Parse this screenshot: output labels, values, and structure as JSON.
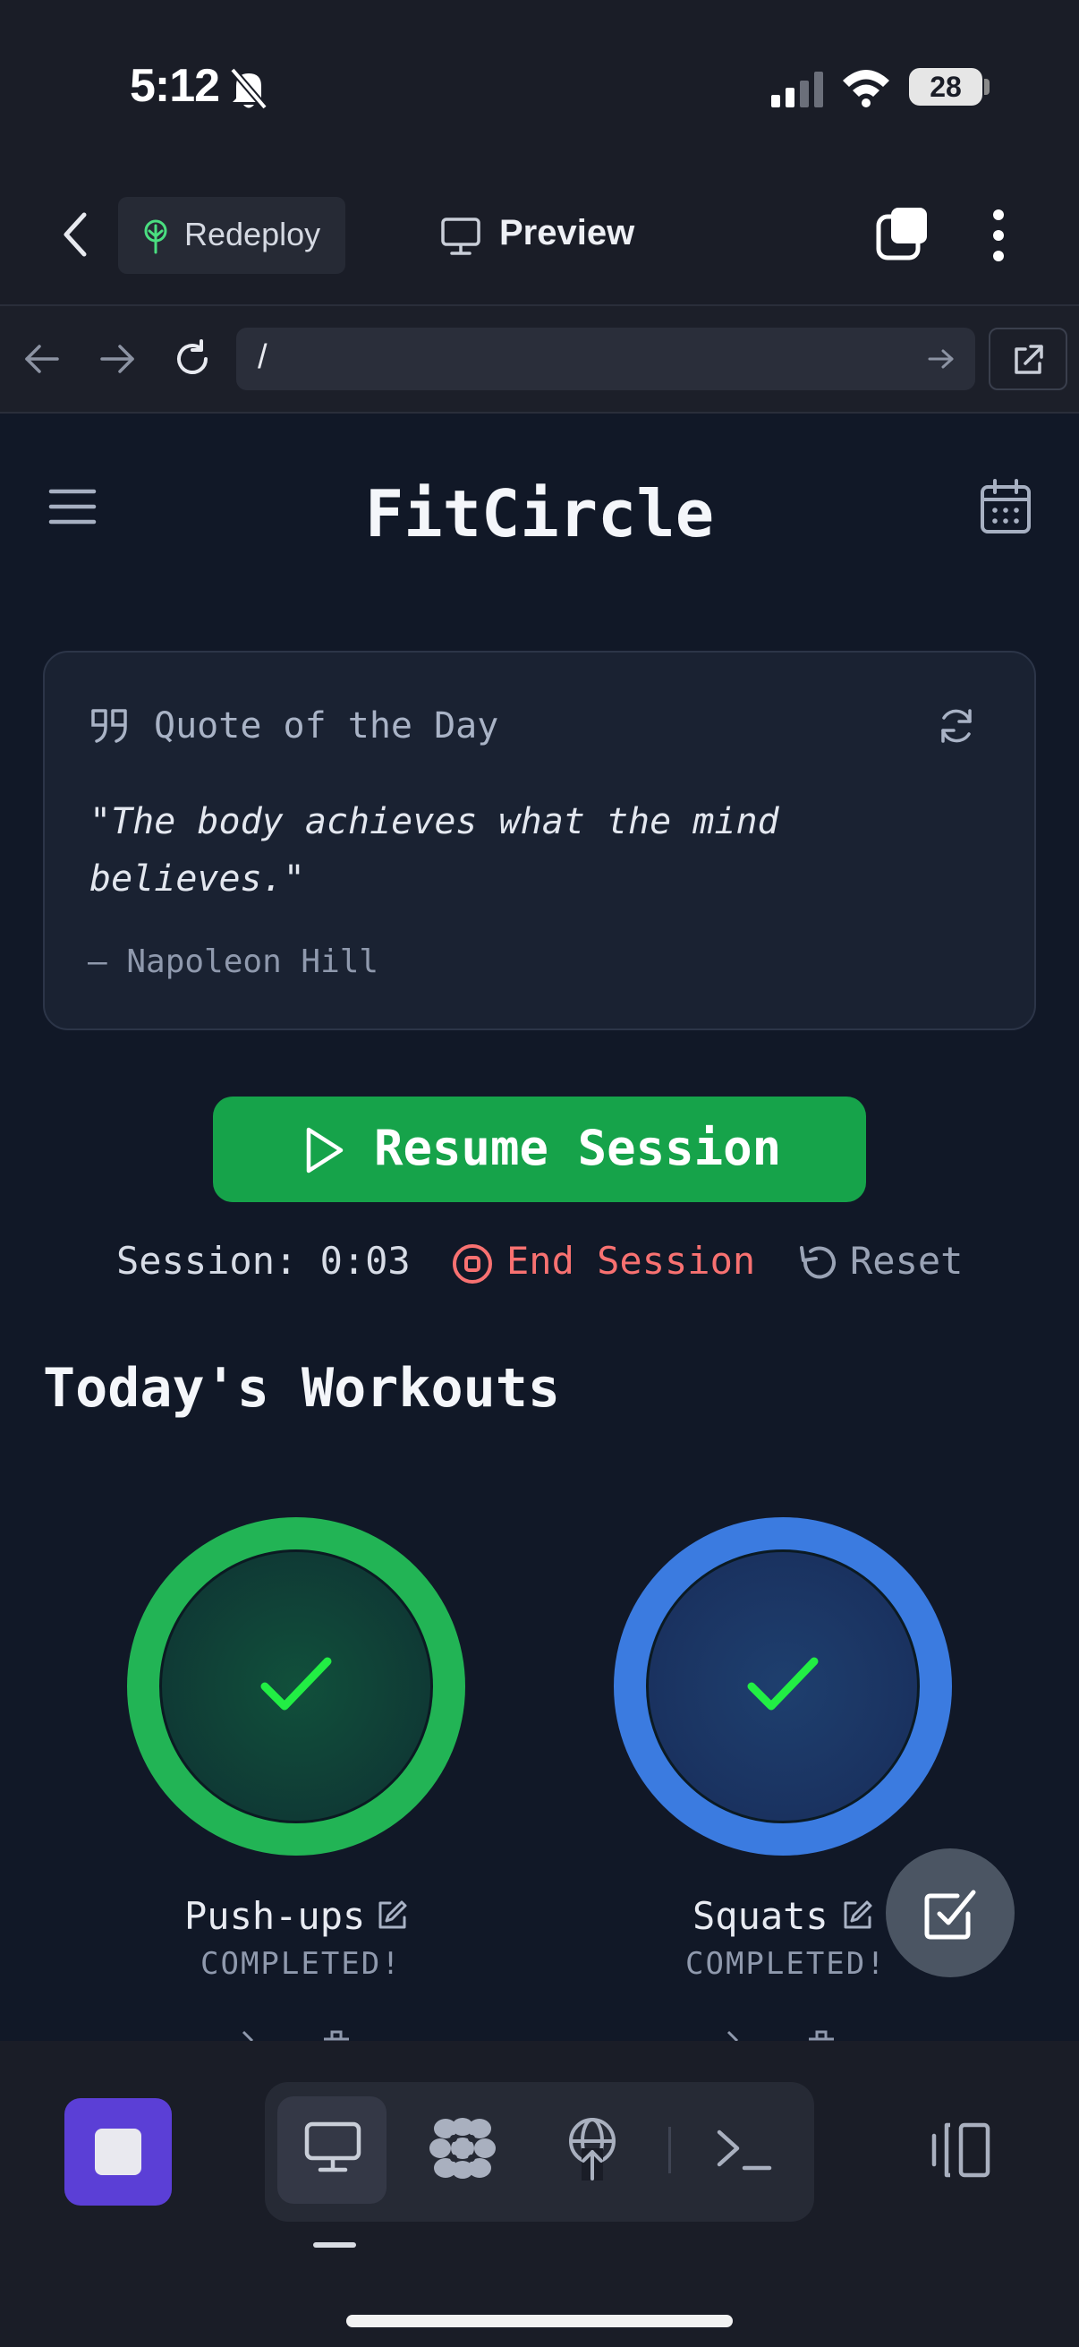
{
  "status_bar": {
    "time": "5:12",
    "battery": "28"
  },
  "header": {
    "redeploy_label": "Redeploy",
    "preview_label": "Preview"
  },
  "url_bar": {
    "url": "/"
  },
  "app": {
    "title": "FitCircle",
    "quote": {
      "heading": "Quote of the Day",
      "text": "\"The body achieves what the mind believes.\"",
      "author": "— Napoleon Hill"
    },
    "resume_label": "Resume Session",
    "session_time": "Session: 0:03",
    "end_session_label": "End Session",
    "reset_label": "Reset",
    "section_title": "Today's Workouts",
    "workouts": [
      {
        "name": "Push-ups",
        "status": "COMPLETED!",
        "ring_color": "#22b455"
      },
      {
        "name": "Squats",
        "status": "COMPLETED!",
        "ring_color": "#3b7be0"
      }
    ]
  },
  "colors": {
    "accent_green": "#16a34a",
    "danger": "#f87171",
    "stop_purple": "#5b3fd6",
    "check_green": "#22ee44"
  },
  "icons": [
    "back-icon",
    "tree-icon",
    "monitor-icon",
    "tabs-icon",
    "more-icon",
    "arrow-left-icon",
    "arrow-right-icon",
    "reload-icon",
    "go-arrow-icon",
    "external-link-icon",
    "menu-icon",
    "calendar-icon",
    "quote-icon",
    "refresh-icon",
    "play-icon",
    "stop-circle-icon",
    "reset-icon",
    "checkmark-icon",
    "edit-icon",
    "check-square-icon",
    "stop-icon",
    "desktop-icon",
    "flower-icon",
    "deploy-icon",
    "terminal-icon",
    "split-view-icon"
  ]
}
